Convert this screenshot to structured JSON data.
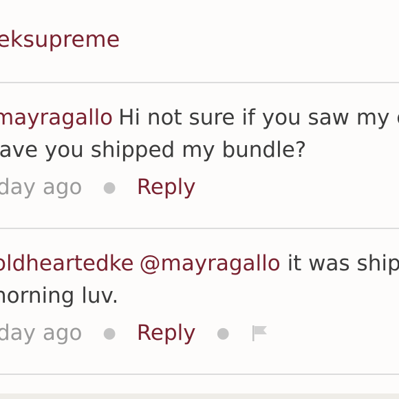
{
  "header": {
    "username": "ieksupreme"
  },
  "comments": [
    {
      "author": "mayragallo",
      "line1": "Hi not sure if you saw my co",
      "line2": "lave you shipped my bundle?",
      "time": "day ago",
      "reply_label": "Reply"
    },
    {
      "author": "oldheartedke",
      "mention": "@mayragallo",
      "line1": "it was shipp",
      "line2": "norning luv.",
      "time": "day ago",
      "reply_label": "Reply"
    }
  ],
  "icons": {
    "flag": "flag-icon"
  },
  "colors": {
    "accent": "#7a2230",
    "text": "#3b3b3b",
    "muted": "#9a9a9a",
    "divider": "#dcdcdc"
  }
}
